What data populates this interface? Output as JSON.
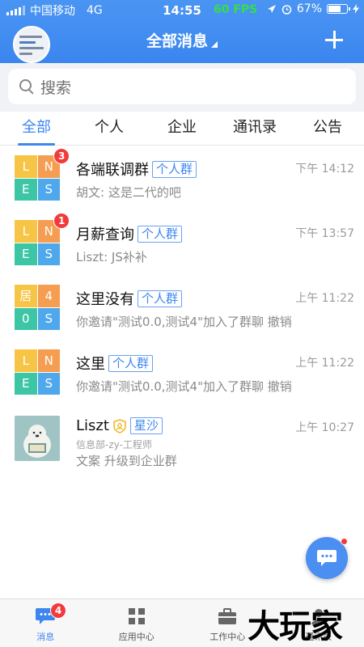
{
  "status_bar": {
    "carrier": "中国移动",
    "network": "4G",
    "time": "14:55",
    "fps": "60 FPS",
    "battery": "67%",
    "battery_level": 0.67
  },
  "header": {
    "title": "全部消息"
  },
  "search": {
    "placeholder": "搜索"
  },
  "tabs": [
    {
      "label": "全部",
      "active": true
    },
    {
      "label": "个人"
    },
    {
      "label": "企业"
    },
    {
      "label": "通讯录"
    },
    {
      "label": "公告"
    }
  ],
  "conversations": [
    {
      "name": "各端联调群",
      "tag": "个人群",
      "time": "下午 14:12",
      "message": "胡文: 这是二代的吧",
      "badge": "3",
      "avatar": [
        "L",
        "N",
        "E",
        "S"
      ]
    },
    {
      "name": "月薪查询",
      "tag": "个人群",
      "time": "下午 13:57",
      "message": "Liszt: JS补补",
      "badge": "1",
      "avatar": [
        "L",
        "N",
        "E",
        "S"
      ]
    },
    {
      "name": "这里没有",
      "tag": "个人群",
      "time": "上午 11:22",
      "message": "你邀请\"测试0.0,测试4\"加入了群聊 撤销",
      "avatar": [
        "居",
        "4",
        "0",
        "S"
      ]
    },
    {
      "name": "这里",
      "tag": "个人群",
      "time": "上午 11:22",
      "message": "你邀请\"测试0.0,测试4\"加入了群聊 撤销",
      "avatar": [
        "L",
        "N",
        "E",
        "S"
      ]
    },
    {
      "name": "Liszt",
      "tag": "星沙",
      "time": "上午 10:27",
      "subtitle": "信息部-zy-工程师",
      "message": "文案   升级到企业群"
    }
  ],
  "bottom_nav": [
    {
      "label": "消息",
      "badge": "4",
      "active": true
    },
    {
      "label": "应用中心"
    },
    {
      "label": "工作中心"
    },
    {
      "label": "通讯录"
    }
  ],
  "watermark": "大玩家",
  "colors": {
    "primary": "#3b86ef",
    "badge": "#f23a3a"
  }
}
